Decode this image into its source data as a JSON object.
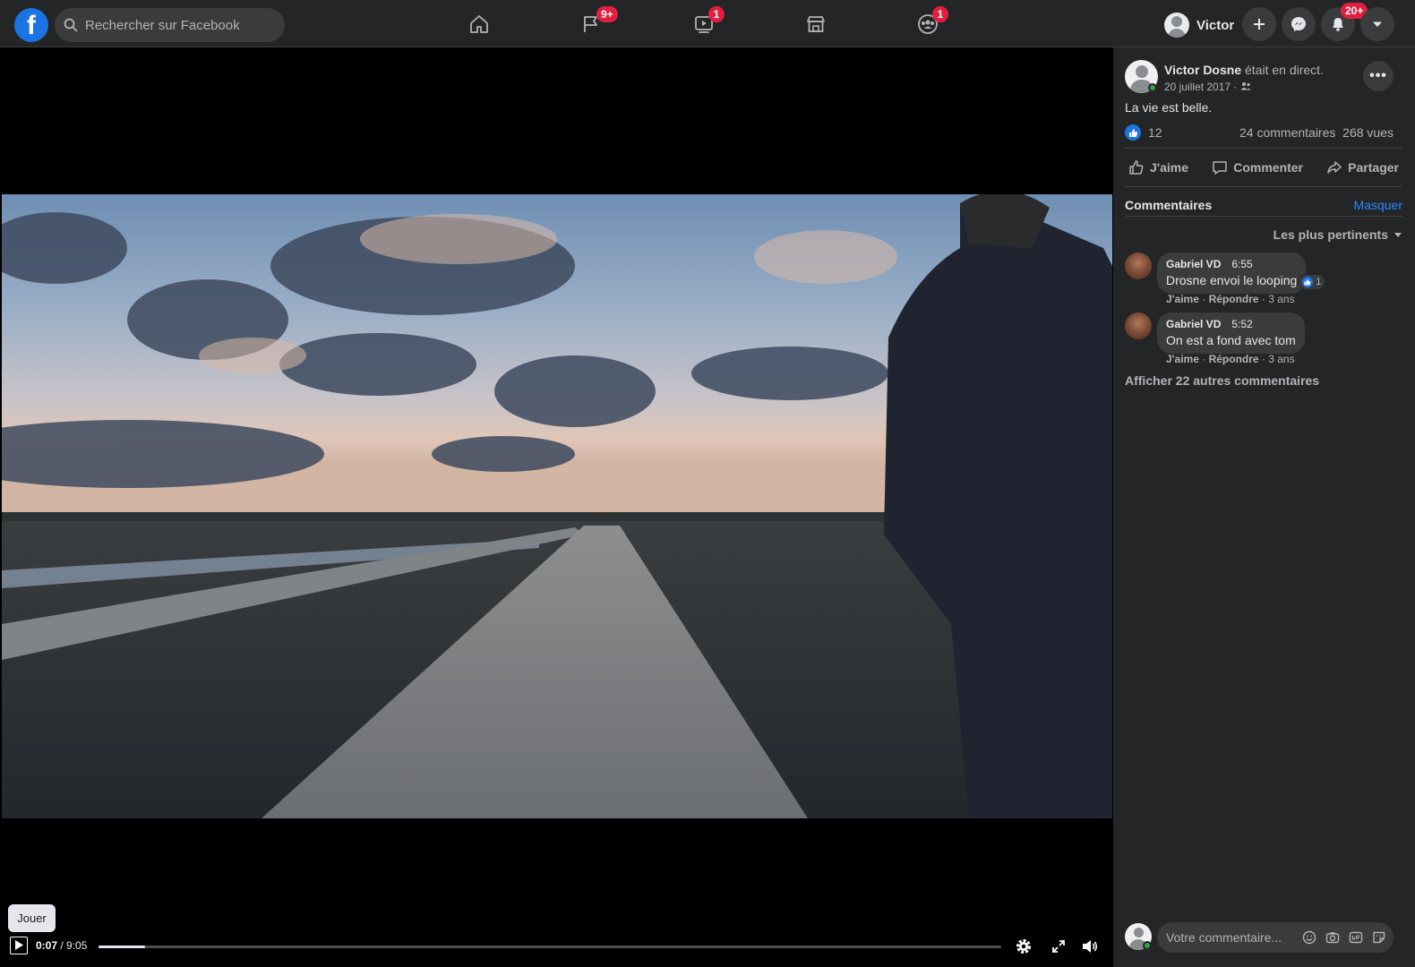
{
  "topbar": {
    "logo_letter": "f",
    "search_placeholder": "Rechercher sur Facebook",
    "nav": [
      {
        "name": "home",
        "badge": ""
      },
      {
        "name": "pages",
        "badge": "9+"
      },
      {
        "name": "watch",
        "badge": "1"
      },
      {
        "name": "marketplace",
        "badge": ""
      },
      {
        "name": "groups",
        "badge": "1"
      }
    ],
    "profile_name": "Victor",
    "notifications_badge": "20+"
  },
  "video": {
    "tooltip": "Jouer",
    "time_current": "0:07",
    "time_total": " / 9:05",
    "progress": 0.013
  },
  "post": {
    "author": "Victor Dosne",
    "author_suffix": " était en direct.",
    "date": "20 juillet 2017 · ",
    "caption": "La vie est belle.",
    "likes": "12",
    "comments_count": "24 commentaires",
    "views": "268 vues",
    "actions": {
      "like": "J'aime",
      "comment": "Commenter",
      "share": "Partager"
    }
  },
  "comments": {
    "title": "Commentaires",
    "hide_label": "Masquer",
    "sort_label": "Les plus pertinents",
    "items": [
      {
        "author": "Gabriel VD",
        "timestamp": "6:55",
        "text": "Drosne envoi le looping",
        "reactions": "1",
        "like": "J'aime",
        "reply": "Répondre",
        "age": "3 ans"
      },
      {
        "author": "Gabriel VD",
        "timestamp": "5:52",
        "text": "On est a fond avec tom",
        "reactions": "",
        "like": "J'aime",
        "reply": "Répondre",
        "age": "3 ans"
      }
    ],
    "more_label": "Afficher 22 autres commentaires",
    "composer_placeholder": "Votre commentaire..."
  },
  "colors": {
    "accent": "#1b74e4",
    "badge": "#e41e3f",
    "panel": "#242526",
    "online": "#31a24c"
  }
}
